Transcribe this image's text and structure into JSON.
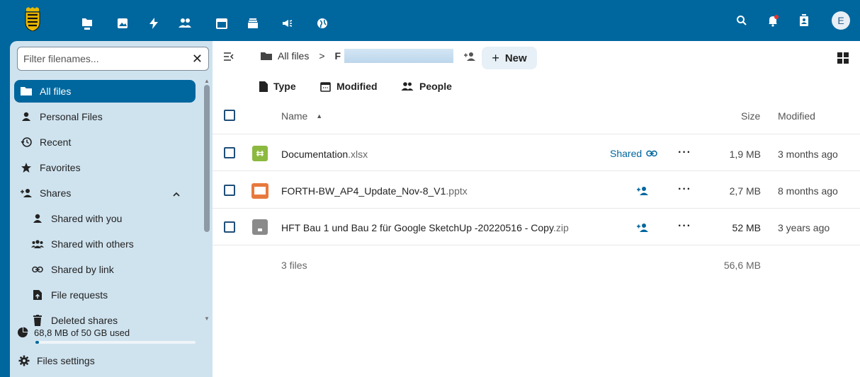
{
  "colors": {
    "brand": "#00679e",
    "sidebar_bg": "#cfe3ef",
    "new_button_bg": "#e6f0f6"
  },
  "topbar": {
    "apps": [
      "files-icon",
      "photos-icon",
      "activity-icon",
      "contacts-icon",
      "calendar-icon",
      "deck-icon",
      "announcements-icon",
      "web-icon"
    ],
    "right": [
      "search-icon",
      "notifications-icon",
      "contacts-menu-icon"
    ],
    "avatar_letter": "E"
  },
  "sidebar": {
    "filter_placeholder": "Filter filenames...",
    "items": [
      {
        "label": "All files",
        "icon": "folder-icon"
      },
      {
        "label": "Personal Files",
        "icon": "person-icon"
      },
      {
        "label": "Recent",
        "icon": "history-icon"
      },
      {
        "label": "Favorites",
        "icon": "star-icon"
      },
      {
        "label": "Shares",
        "icon": "share-icon"
      },
      {
        "label": "Shared with you",
        "icon": "person-icon"
      },
      {
        "label": "Shared with others",
        "icon": "group-icon"
      },
      {
        "label": "Shared by link",
        "icon": "link-icon"
      },
      {
        "label": "File requests",
        "icon": "file-upload-icon"
      },
      {
        "label": "Deleted shares",
        "icon": "trash-icon"
      }
    ],
    "quota_text": "68,8 MB of 50 GB used",
    "quota_fraction": 0.0013,
    "settings_label": "Files settings"
  },
  "breadcrumb": {
    "root": "All files",
    "separator": ">",
    "current": "F"
  },
  "toolbar": {
    "new_label": "New"
  },
  "filters": {
    "type": "Type",
    "modified": "Modified",
    "people": "People"
  },
  "table": {
    "headers": {
      "name": "Name",
      "size": "Size",
      "modified": "Modified"
    },
    "rows": [
      {
        "basename": "Documentation",
        "ext": ".xlsx",
        "shared": "Shared",
        "size": "1,9 MB",
        "modified": "3 months ago",
        "type": "spreadsheet"
      },
      {
        "basename": "FORTH-BW_AP4_Update_Nov-8_V1",
        "ext": ".pptx",
        "shared": "",
        "size": "2,7 MB",
        "modified": "8 months ago",
        "type": "presentation"
      },
      {
        "basename": "HFT Bau 1 und Bau 2 für Google SketchUp -20220516 - Copy",
        "ext": ".zip",
        "shared": "",
        "size": "52 MB",
        "modified": "3 years ago",
        "type": "archive"
      }
    ],
    "summary": {
      "files": "3 files",
      "size": "56,6 MB"
    }
  }
}
